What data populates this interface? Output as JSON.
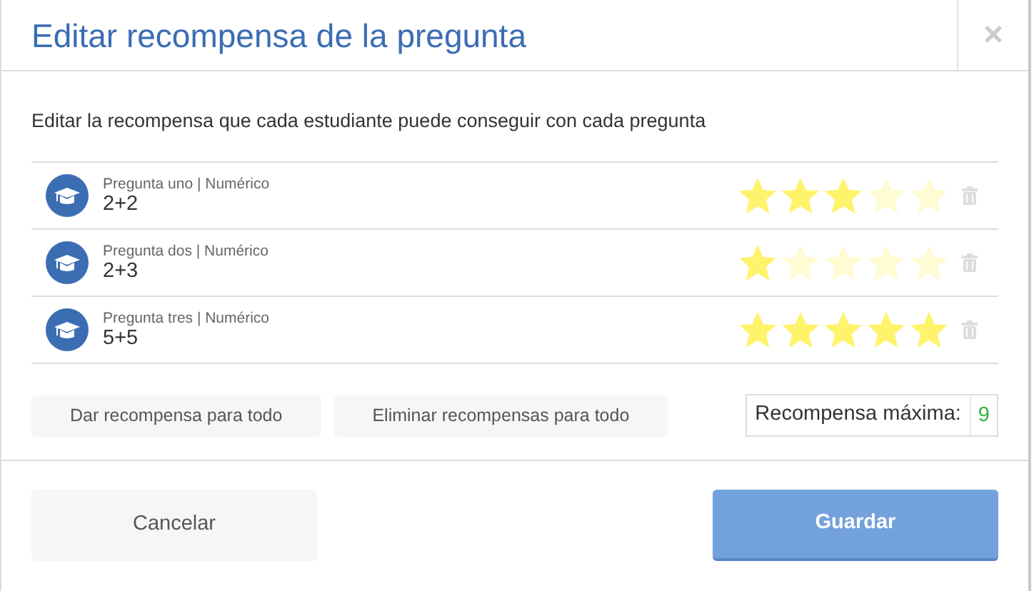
{
  "dialog": {
    "title": "Editar recompensa de la pregunta",
    "close": "×"
  },
  "description": "Editar la recompensa que cada estudiante puede conseguir con cada pregunta",
  "questions": [
    {
      "label": "Pregunta uno | Numérico",
      "text": "2+2",
      "stars": 3
    },
    {
      "label": "Pregunta dos | Numérico",
      "text": "2+3",
      "stars": 1
    },
    {
      "label": "Pregunta tres | Numérico",
      "text": "5+5",
      "stars": 5
    }
  ],
  "actions": [
    "Dar recompensa para todo",
    "Eliminar recompensas para todo"
  ],
  "max_reward": {
    "label": "Recompensa máxima:",
    "value": "9"
  },
  "footer": {
    "cancel": "Cancelar",
    "save": "Guardar"
  }
}
